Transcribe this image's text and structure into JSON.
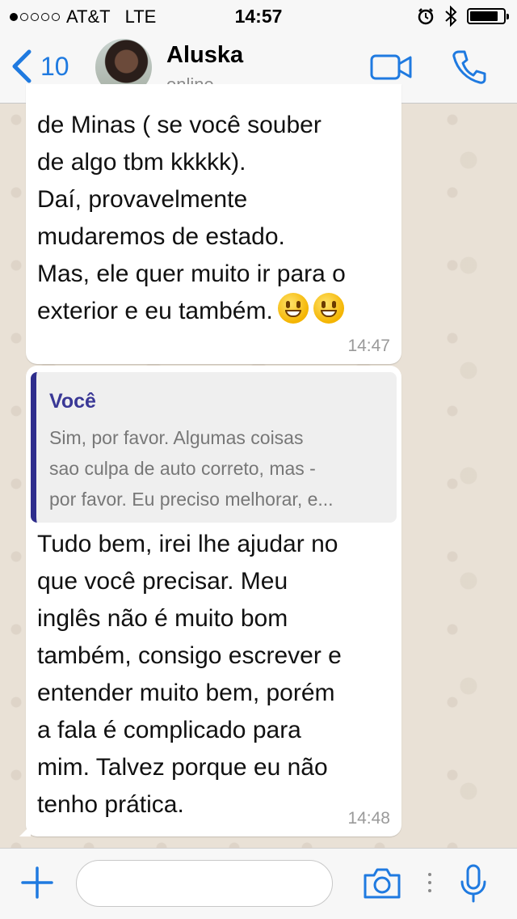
{
  "status_bar": {
    "carrier": "AT&T",
    "network": "LTE",
    "time": "14:57",
    "signal_bars_filled": 1,
    "signal_bars_total": 5,
    "battery_level": 0.85
  },
  "header": {
    "back_count": "10",
    "contact_name": "Aluska",
    "contact_status": "online",
    "accent_color": "#1f7ae0"
  },
  "messages": [
    {
      "text": "de Minas ( se você souber\nde algo tbm kkkkk).\nDaí, provavelmente\nmudaremos de estado.\nMas, ele quer muito ir para o\nexterior e eu também.",
      "emojis": "😀😀",
      "time": "14:47"
    },
    {
      "quote_author": "Você",
      "quote_text": "Sim, por favor.  Algumas coisas\nsao culpa de auto correto, mas -\npor favor. Eu preciso melhorar, e...",
      "text": "Tudo bem, irei lhe ajudar no\nque você precisar. Meu\ninglês não é muito bom\ntambém, consigo escrever e\nentender muito bem, porém\na fala é complicado para\nmim. Talvez porque eu não\ntenho prática.",
      "time": "14:48"
    }
  ],
  "input_bar": {
    "placeholder": ""
  }
}
